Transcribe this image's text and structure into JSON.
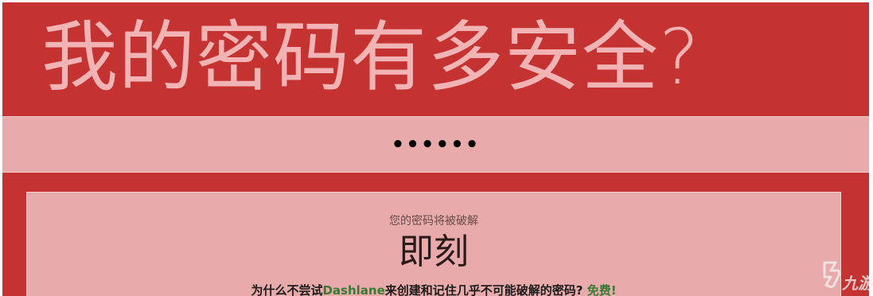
{
  "header": {
    "title": "我的密码有多安全?"
  },
  "password_field": {
    "value": "••••••"
  },
  "result": {
    "caption": "您的密码将被破解",
    "time": "即刻"
  },
  "promo": {
    "prefix": "为什么不尝试",
    "brand": "Dashlane",
    "middle": "来创建和记住几乎不可能破解的密码?",
    "cta": "免费!"
  },
  "watermark": {
    "text": "九游"
  },
  "colors": {
    "background": "#c43232",
    "panel": "#e8aaaa",
    "title": "#f1b3b3",
    "accent_green": "#3a7a36"
  }
}
